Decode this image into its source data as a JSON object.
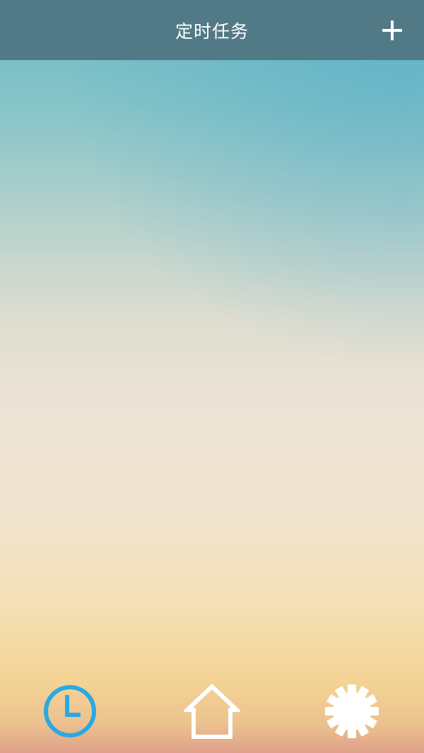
{
  "header": {
    "title": "定时任务",
    "add_icon": "plus-icon"
  },
  "tabs": [
    {
      "icon": "clock-icon",
      "active": true,
      "color": "#29a9e6"
    },
    {
      "icon": "home-icon",
      "active": false,
      "color": "#ffffff"
    },
    {
      "icon": "gear-icon",
      "active": false,
      "color": "#ffffff"
    }
  ],
  "colors": {
    "header_background": "#527a86",
    "active_tab": "#29a9e6",
    "inactive_tab": "#ffffff"
  }
}
